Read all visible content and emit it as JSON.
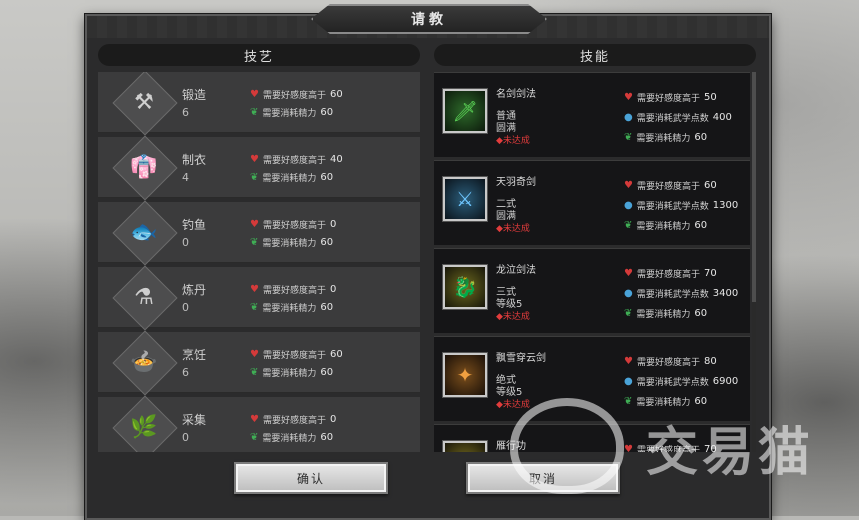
{
  "dialog": {
    "title": "请教"
  },
  "left_panel": {
    "header": "技艺",
    "items": [
      {
        "name": "锻造",
        "level": "6",
        "req_favor": "需要好感度高于",
        "favor_value": "60",
        "req_stamina": "需要消耗精力",
        "stamina_value": "60",
        "icon": "forge-icon",
        "glyph": "⚒"
      },
      {
        "name": "制衣",
        "level": "4",
        "req_favor": "需要好感度高于",
        "favor_value": "40",
        "req_stamina": "需要消耗精力",
        "stamina_value": "60",
        "icon": "tailoring-icon",
        "glyph": "👘"
      },
      {
        "name": "钓鱼",
        "level": "0",
        "req_favor": "需要好感度高于",
        "favor_value": "0",
        "req_stamina": "需要消耗精力",
        "stamina_value": "60",
        "icon": "fishing-icon",
        "glyph": "🐟"
      },
      {
        "name": "炼丹",
        "level": "0",
        "req_favor": "需要好感度高于",
        "favor_value": "0",
        "req_stamina": "需要消耗精力",
        "stamina_value": "60",
        "icon": "alchemy-icon",
        "glyph": "⚗"
      },
      {
        "name": "烹饪",
        "level": "6",
        "req_favor": "需要好感度高于",
        "favor_value": "60",
        "req_stamina": "需要消耗精力",
        "stamina_value": "60",
        "icon": "cooking-icon",
        "glyph": "🍲"
      },
      {
        "name": "采集",
        "level": "0",
        "req_favor": "需要好感度高于",
        "favor_value": "0",
        "req_stamina": "需要消耗精力",
        "stamina_value": "60",
        "icon": "gathering-icon",
        "glyph": "🌿"
      }
    ]
  },
  "right_panel": {
    "header": "技能",
    "items": [
      {
        "name": "名剑剑法",
        "tier": "普通",
        "level": "圆满",
        "status": "◆未达成",
        "req_favor": "需要好感度高于",
        "favor_value": "50",
        "req_points": "需要消耗武学点数",
        "points_value": "400",
        "req_stamina": "需要消耗精力",
        "stamina_value": "60",
        "icon": "sword-art-green-icon",
        "color": "#5fdc5a"
      },
      {
        "name": "天羽奇剑",
        "tier": "二式",
        "level": "圆满",
        "status": "◆未达成",
        "req_favor": "需要好感度高于",
        "favor_value": "60",
        "req_points": "需要消耗武学点数",
        "points_value": "1300",
        "req_stamina": "需要消耗精力",
        "stamina_value": "60",
        "icon": "sword-art-blue-icon",
        "color": "#6fc6ff"
      },
      {
        "name": "龙泣剑法",
        "tier": "三式",
        "level": "等级5",
        "status": "◆未达成",
        "req_favor": "需要好感度高于",
        "favor_value": "70",
        "req_points": "需要消耗武学点数",
        "points_value": "3400",
        "req_stamina": "需要消耗精力",
        "stamina_value": "60",
        "icon": "sword-art-yellow-icon",
        "color": "#e9e34a"
      },
      {
        "name": "飘雪穿云剑",
        "tier": "绝式",
        "level": "等级5",
        "status": "◆未达成",
        "req_favor": "需要好感度高于",
        "favor_value": "80",
        "req_points": "需要消耗武学点数",
        "points_value": "6900",
        "req_stamina": "需要消耗精力",
        "stamina_value": "60",
        "icon": "sword-art-orange-icon",
        "color": "#f0a040"
      },
      {
        "name": "雁行功",
        "tier": "",
        "level": "",
        "status": "",
        "req_favor": "需要好感度高于",
        "favor_value": "70",
        "req_points": "",
        "points_value": "",
        "req_stamina": "",
        "stamina_value": "",
        "icon": "qinggong-icon",
        "color": "#f0e070"
      }
    ]
  },
  "buttons": {
    "confirm": "确认",
    "cancel": "取消"
  },
  "watermark": {
    "text": "交易猫"
  }
}
